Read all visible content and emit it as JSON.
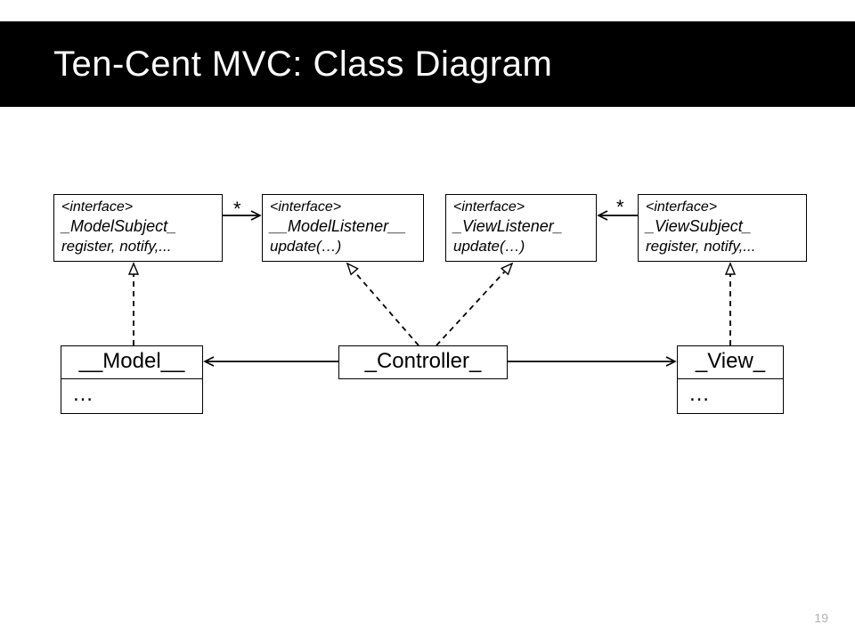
{
  "title": "Ten-Cent MVC: Class Diagram",
  "page_number": "19",
  "interfaces": {
    "model_subject": {
      "stereo": "<interface>",
      "name": "_ModelSubject_",
      "ops": "register, notify,..."
    },
    "model_listener": {
      "stereo": "<interface>",
      "name": "__ModelListener__",
      "ops": "update(…)"
    },
    "view_listener": {
      "stereo": "<interface>",
      "name": "_ViewListener_",
      "ops": "update(…)"
    },
    "view_subject": {
      "stereo": "<interface>",
      "name": "_ViewSubject_",
      "ops": "register, notify,..."
    }
  },
  "classes": {
    "model": {
      "name": "__Model__",
      "body": "…"
    },
    "controller": {
      "name": "_Controller_",
      "body": ""
    },
    "view": {
      "name": "_View_",
      "body": "…"
    }
  },
  "multiplicities": {
    "left": "*",
    "right": "*"
  },
  "connectors": [
    {
      "id": "ms-to-ml",
      "from": "model-subject",
      "to": "model-listener",
      "style": "solid",
      "arrow": "open",
      "mult": "*"
    },
    {
      "id": "vs-to-vl",
      "from": "view-subject",
      "to": "view-listener",
      "style": "solid",
      "arrow": "open",
      "mult": "*"
    },
    {
      "id": "model-impl",
      "from": "model",
      "to": "model-subject",
      "style": "dashed",
      "arrow": "hollow"
    },
    {
      "id": "view-impl",
      "from": "view",
      "to": "view-subject",
      "style": "dashed",
      "arrow": "hollow"
    },
    {
      "id": "ctrl-ml",
      "from": "controller",
      "to": "model-listener",
      "style": "dashed",
      "arrow": "hollow"
    },
    {
      "id": "ctrl-vl",
      "from": "controller",
      "to": "view-listener",
      "style": "dashed",
      "arrow": "hollow"
    },
    {
      "id": "ctrl-model",
      "from": "controller",
      "to": "model",
      "style": "solid",
      "arrow": "open"
    },
    {
      "id": "ctrl-view",
      "from": "controller",
      "to": "view",
      "style": "solid",
      "arrow": "open"
    }
  ]
}
